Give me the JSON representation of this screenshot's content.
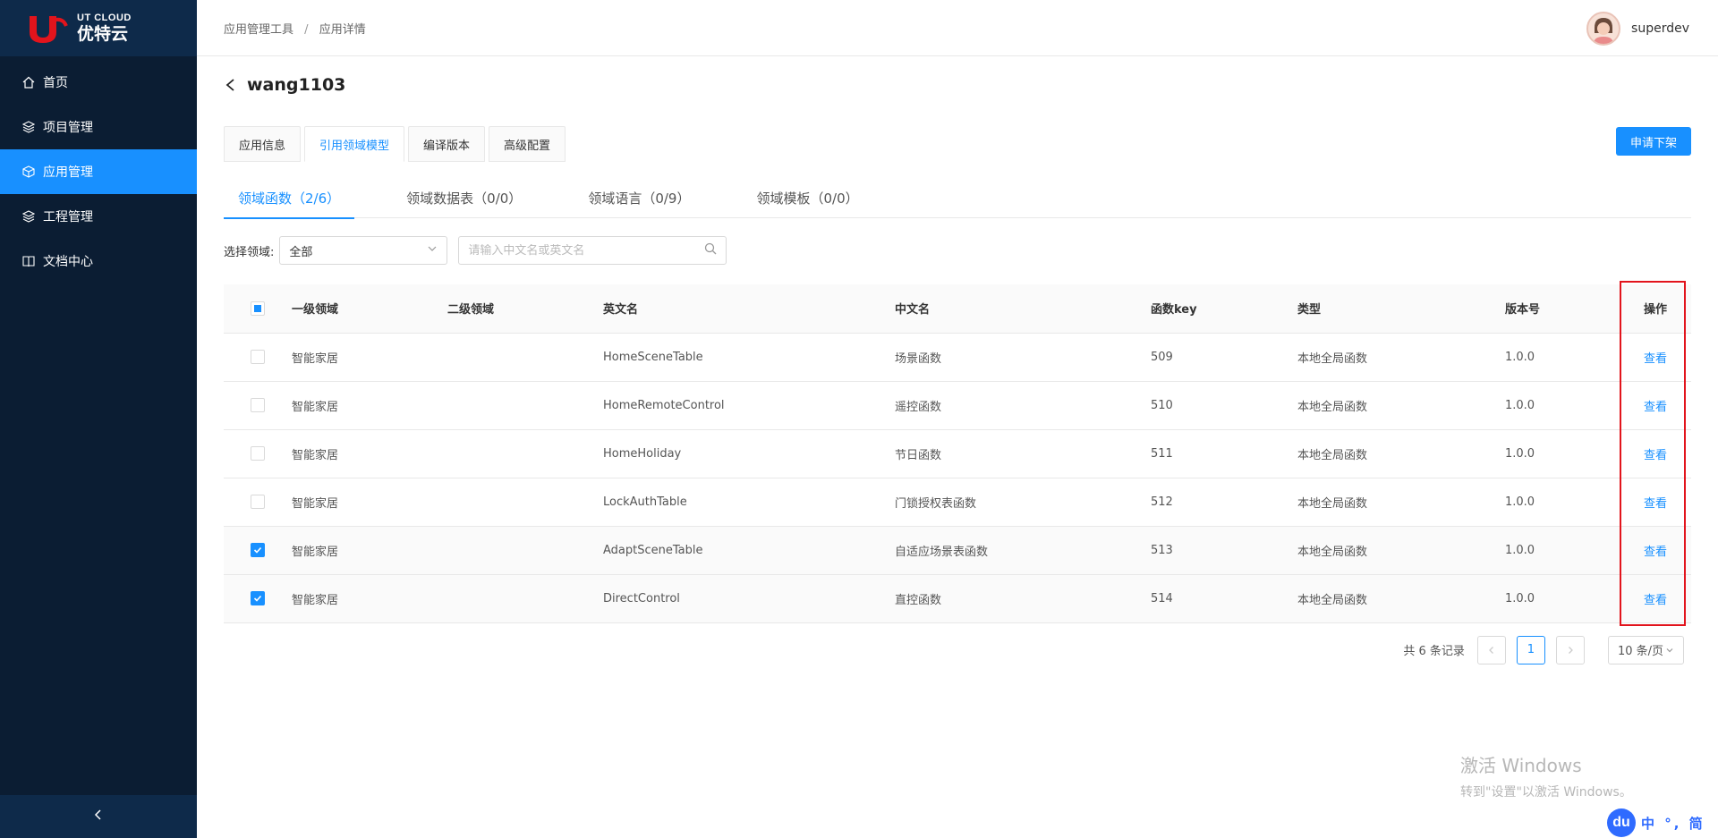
{
  "brand": {
    "name_en": "UT CLOUD",
    "name_cn": "优特云",
    "logo_letter": "U"
  },
  "sidebar": {
    "items": [
      {
        "label": "首页",
        "icon": "home-icon"
      },
      {
        "label": "项目管理",
        "icon": "layers-icon"
      },
      {
        "label": "应用管理",
        "icon": "cube-icon",
        "active": true
      },
      {
        "label": "工程管理",
        "icon": "layers-icon"
      },
      {
        "label": "文档中心",
        "icon": "book-icon"
      }
    ],
    "collapse_icon": "chevron-left-icon"
  },
  "header": {
    "breadcrumb": [
      "应用管理工具",
      "应用详情"
    ],
    "breadcrumb_sep": "/",
    "username": "superdev"
  },
  "page": {
    "title": "wang1103",
    "tabs": [
      "应用信息",
      "引用领域模型",
      "编译版本",
      "高级配置"
    ],
    "active_tab": 1,
    "action_button": "申请下架"
  },
  "subtabs": {
    "items": [
      "领域函数（2/6）",
      "领域数据表（0/0）",
      "领域语言（0/9）",
      "领域模板（0/0）"
    ],
    "active": 0
  },
  "filter": {
    "label": "选择领域:",
    "select_value": "全部",
    "search_placeholder": "请输入中文名或英文名"
  },
  "table": {
    "columns": [
      "一级领域",
      "二级领域",
      "英文名",
      "中文名",
      "函数key",
      "类型",
      "版本号",
      "操作"
    ],
    "rows": [
      {
        "level1": "智能家居",
        "level2": "",
        "en": "HomeSceneTable",
        "cn": "场景函数",
        "key": "509",
        "type": "本地全局函数",
        "version": "1.0.0",
        "action": "查看",
        "checked": false
      },
      {
        "level1": "智能家居",
        "level2": "",
        "en": "HomeRemoteControl",
        "cn": "遥控函数",
        "key": "510",
        "type": "本地全局函数",
        "version": "1.0.0",
        "action": "查看",
        "checked": false
      },
      {
        "level1": "智能家居",
        "level2": "",
        "en": "HomeHoliday",
        "cn": "节日函数",
        "key": "511",
        "type": "本地全局函数",
        "version": "1.0.0",
        "action": "查看",
        "checked": false
      },
      {
        "level1": "智能家居",
        "level2": "",
        "en": "LockAuthTable",
        "cn": "门锁授权表函数",
        "key": "512",
        "type": "本地全局函数",
        "version": "1.0.0",
        "action": "查看",
        "checked": false
      },
      {
        "level1": "智能家居",
        "level2": "",
        "en": "AdaptSceneTable",
        "cn": "自适应场景表函数",
        "key": "513",
        "type": "本地全局函数",
        "version": "1.0.0",
        "action": "查看",
        "checked": true
      },
      {
        "level1": "智能家居",
        "level2": "",
        "en": "DirectControl",
        "cn": "直控函数",
        "key": "514",
        "type": "本地全局函数",
        "version": "1.0.0",
        "action": "查看",
        "checked": true
      }
    ]
  },
  "pagination": {
    "total": "共 6 条记录",
    "current_page": "1",
    "page_size": "10 条/页"
  },
  "watermark": {
    "title": "激活 Windows",
    "subtitle": "转到\"设置\"以激活 Windows。"
  },
  "ime": {
    "logo": "du",
    "text": "中 °, 简"
  },
  "colors": {
    "sidebar_bg": "#0b1d33",
    "accent": "#1890ff",
    "highlight": "#e2141c"
  }
}
